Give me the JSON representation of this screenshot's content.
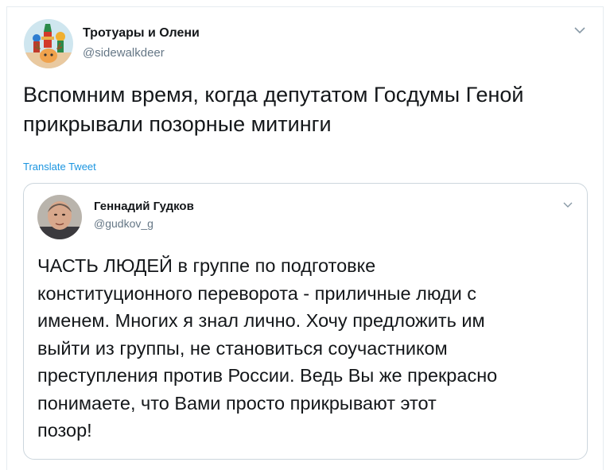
{
  "tweet": {
    "author_name": "Тротуары и Олени",
    "author_handle": "@sidewalkdeer",
    "text": "Вспомним время, когда депутатом Госдумы Геной\nприкрывали позорные митинги",
    "translate_label": "Translate Tweet"
  },
  "quote": {
    "author_name": "Геннадий Гудков",
    "author_handle": "@gudkov_g",
    "text": "ЧАСТЬ ЛЮДЕЙ в группе по подготовке\nконституционного переворота - приличные люди с\nименем. Многих я знал лично. Хочу предложить им\nвыйти из группы, не становиться соучастником\nпреступления против России. Ведь Вы же прекрасно\nпонимаете, что Вами просто прикрывают этот\nпозор!"
  },
  "icons": {
    "tweet_menu": "chevron-down-icon",
    "quote_menu": "chevron-down-icon"
  },
  "colors": {
    "link": "#1b95e0",
    "secondary_text": "#657786",
    "border": "#ccd6dd"
  }
}
